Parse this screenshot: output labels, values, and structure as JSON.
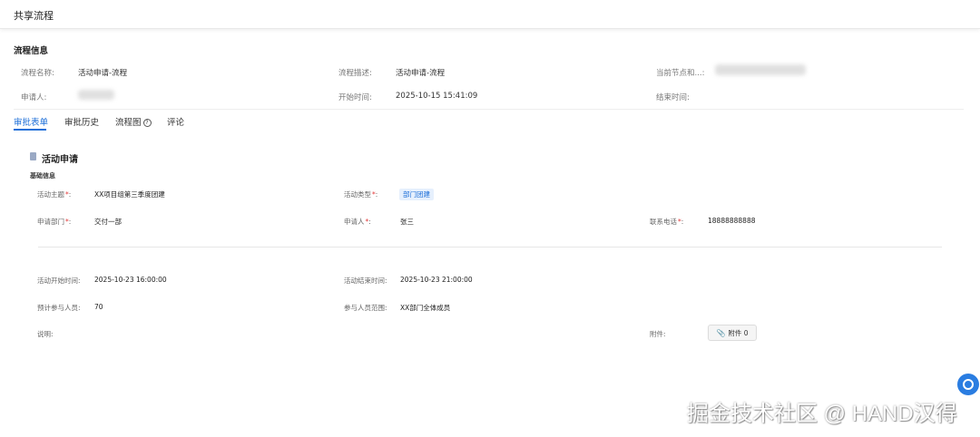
{
  "header": {
    "title": "共享流程"
  },
  "process_info": {
    "section_title": "流程信息",
    "name_label": "流程名称:",
    "name_value": "活动申请-流程",
    "desc_label": "流程描述:",
    "desc_value": "活动申请-流程",
    "node_label": "当前节点和...:",
    "applicant_label": "申请人:",
    "start_label": "开始时间:",
    "start_value": "2025-10-15 15:41:09",
    "end_label": "结束时间:"
  },
  "tabs": [
    {
      "label": "审批表单",
      "active": true
    },
    {
      "label": "审批历史",
      "active": false
    },
    {
      "label": "流程图",
      "active": false
    },
    {
      "label": "评论",
      "active": false
    }
  ],
  "form": {
    "title": "活动申请",
    "subheading": "基础信息",
    "required_mark": "*",
    "fields": {
      "subject_label": "活动主题",
      "subject_value": "XX项目组第三季度团建",
      "type_label": "活动类型",
      "type_value": "部门团建",
      "dept_label": "申请部门",
      "dept_value": "交付一部",
      "applicant_label": "申请人",
      "applicant_value": "张三",
      "phone_label": "联系电话",
      "phone_value": "18888888888",
      "start_label": "活动开始时间:",
      "start_value": "2025-10-23 16:00:00",
      "end_label": "活动结束时间:",
      "end_value": "2025-10-23 21:00:00",
      "expected_label": "预计参与人员:",
      "expected_value": "70",
      "scope_label": "参与人员范围:",
      "scope_value": "XX部门全体成员",
      "desc_label": "说明:",
      "attach_label": "附件:",
      "attach_button": "附件 0"
    }
  },
  "watermark": "掘金技术社区 @ HAND汉得",
  "colors": {
    "accent": "#1d6fd8",
    "required": "#e23b3b",
    "tag_bg": "#e6f0fd"
  },
  "icons": [
    "document-icon",
    "help-circle-icon",
    "paperclip-icon",
    "chat-icon"
  ]
}
